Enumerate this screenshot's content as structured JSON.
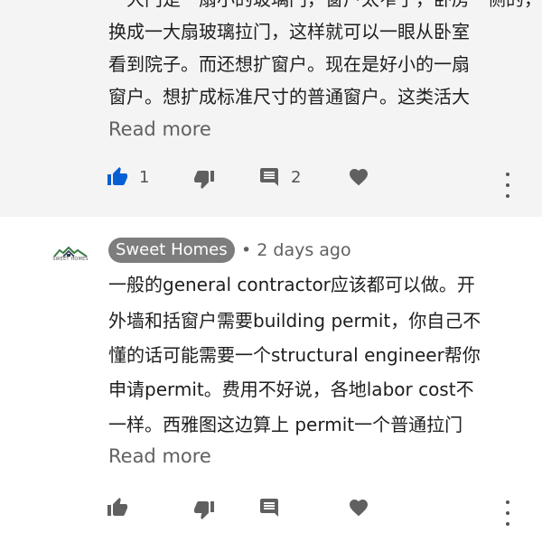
{
  "comment_1": {
    "lines": [
      "一大门是一扇小的玻璃门，窗户太窄了，卧房一侧的，",
      "换成一大扇玻璃拉门，这样就可以一眼从卧室",
      "看到院子。而还想扩窗户。现在是好小的一扇",
      "窗户。想扩成标准尺寸的普通窗户。这类活大"
    ],
    "read_more": "Read more",
    "like_count": "1",
    "reply_count": "2"
  },
  "comment_2": {
    "avatar_text": "SWEET HOMES",
    "author": "Sweet Homes",
    "separator": "•",
    "time_ago": "2 days ago",
    "lines": [
      "一般的general contractor应该都可以做。开",
      "外墙和括窗户需要building permit，你自己不",
      "懂的话可能需要一个structural engineer帮你",
      "申请permit。费用不好说，各地labor cost不",
      "一样。西雅图这边算上 permit一个普通拉门"
    ],
    "read_more": "Read more"
  },
  "icons": {
    "like": "thumb-up-icon",
    "dislike": "thumb-down-icon",
    "reply": "comment-icon",
    "heart": "heart-icon",
    "more": "more-vert-icon"
  },
  "colors": {
    "liked_thumb": "#065fd4",
    "icon_gray": "#606060",
    "chip_bg": "#7d7d7d"
  }
}
